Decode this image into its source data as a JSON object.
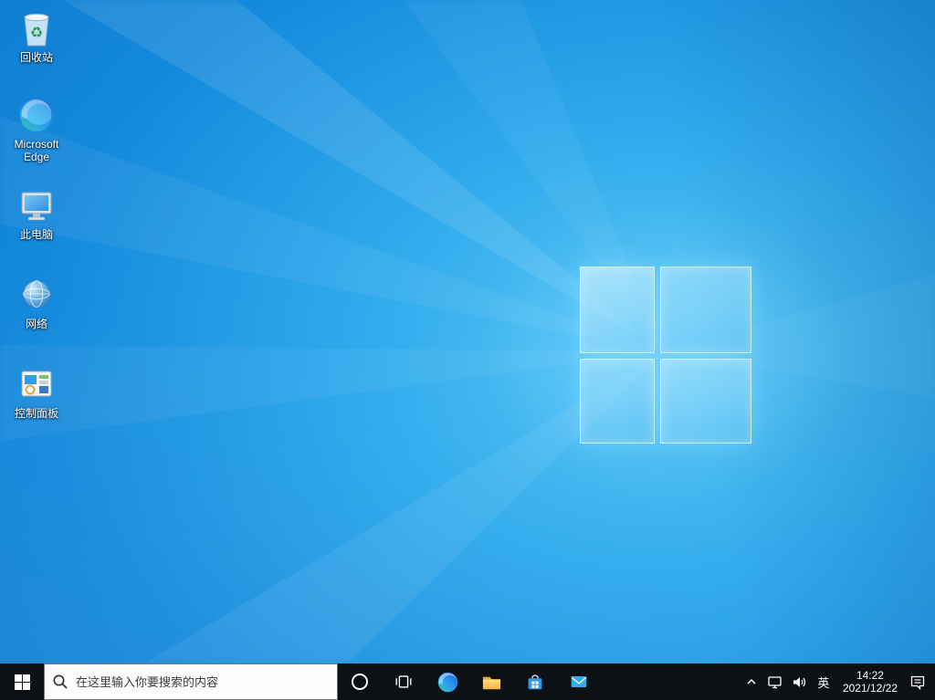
{
  "desktop": {
    "icons": [
      {
        "id": "recycle-bin",
        "label": "回收站"
      },
      {
        "id": "microsoft-edge",
        "label": "Microsoft Edge"
      },
      {
        "id": "this-pc",
        "label": "此电脑"
      },
      {
        "id": "network",
        "label": "网络"
      },
      {
        "id": "control-panel",
        "label": "控制面板"
      }
    ]
  },
  "taskbar": {
    "start_button": "windows-start",
    "search": {
      "placeholder": "在这里输入你要搜索的内容",
      "icon": "search-icon"
    },
    "app_buttons": [
      "cortana",
      "task-view",
      "microsoft-edge",
      "file-explorer",
      "microsoft-store",
      "mail"
    ],
    "tray": {
      "overflow_icon": "chevron-up-icon",
      "network_icon": "ethernet-network-icon",
      "volume_icon": "speaker-icon",
      "ime_label": "英",
      "clock": {
        "time": "14:22",
        "date": "2021/12/22"
      },
      "action_center_icon": "action-center-icon"
    }
  },
  "colors": {
    "taskbar_bg": "#0d1014",
    "desktop_accent": "#1489dc",
    "logo_glow": "#82daff",
    "folder_yellow": "#ffd05e",
    "search_box_bg": "#fdfdfd"
  }
}
